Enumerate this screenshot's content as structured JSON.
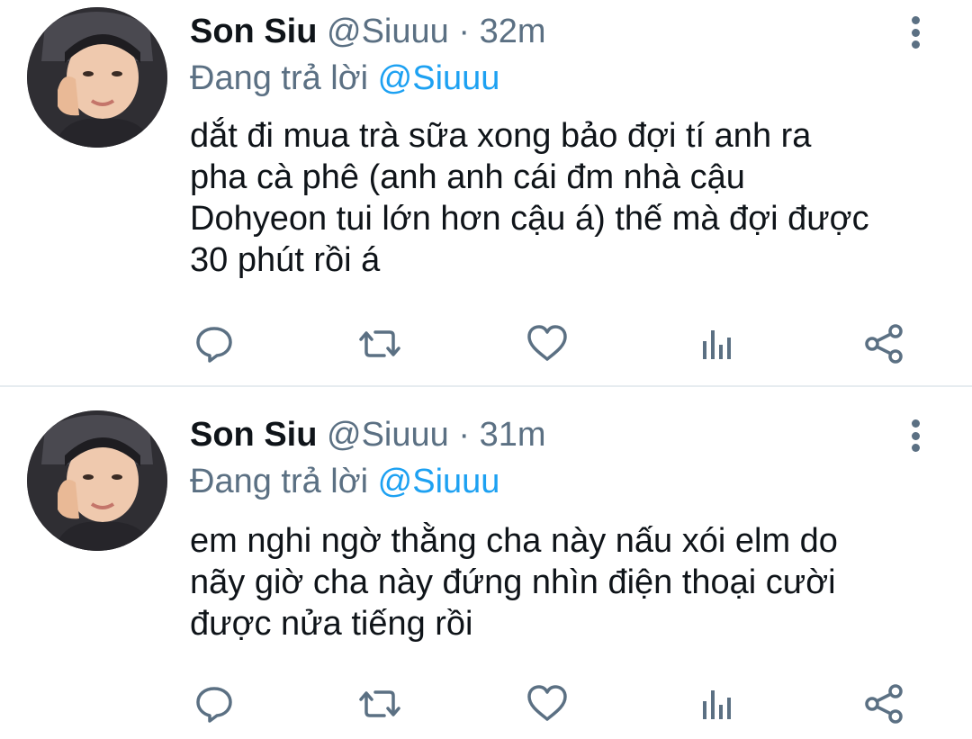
{
  "colors": {
    "link": "#1da1f2",
    "secondary_text": "#5b7083",
    "primary_text": "#0f1419",
    "divider": "#e6ecf0"
  },
  "tweets": [
    {
      "name": "Son Siu",
      "handle": "@Siuuu",
      "separator": "·",
      "time": "32m",
      "replying_prefix": "Đang trả lời",
      "replying_to": "@Siuuu",
      "text_lines": [
        "dắt đi mua trà sữa xong bảo đợi tí anh ra",
        "pha cà phê (anh anh cái đm nhà cậu",
        "Dohyeon tui lớn hơn cậu á) thế mà đợi được",
        "30 phút rồi á"
      ],
      "actions": [
        "reply-icon",
        "retweet-icon",
        "like-icon",
        "stats-icon",
        "share-icon"
      ]
    },
    {
      "name": "Son Siu",
      "handle": "@Siuuu",
      "separator": "·",
      "time": "31m",
      "replying_prefix": "Đang trả lời",
      "replying_to": "@Siuuu",
      "text_lines": [
        "em nghi ngờ thằng cha này nấu xói elm do",
        "nãy giờ cha này đứng nhìn điện thoại cười",
        "được nửa tiếng rồi"
      ],
      "actions": [
        "reply-icon",
        "retweet-icon",
        "like-icon",
        "stats-icon",
        "share-icon"
      ]
    }
  ]
}
